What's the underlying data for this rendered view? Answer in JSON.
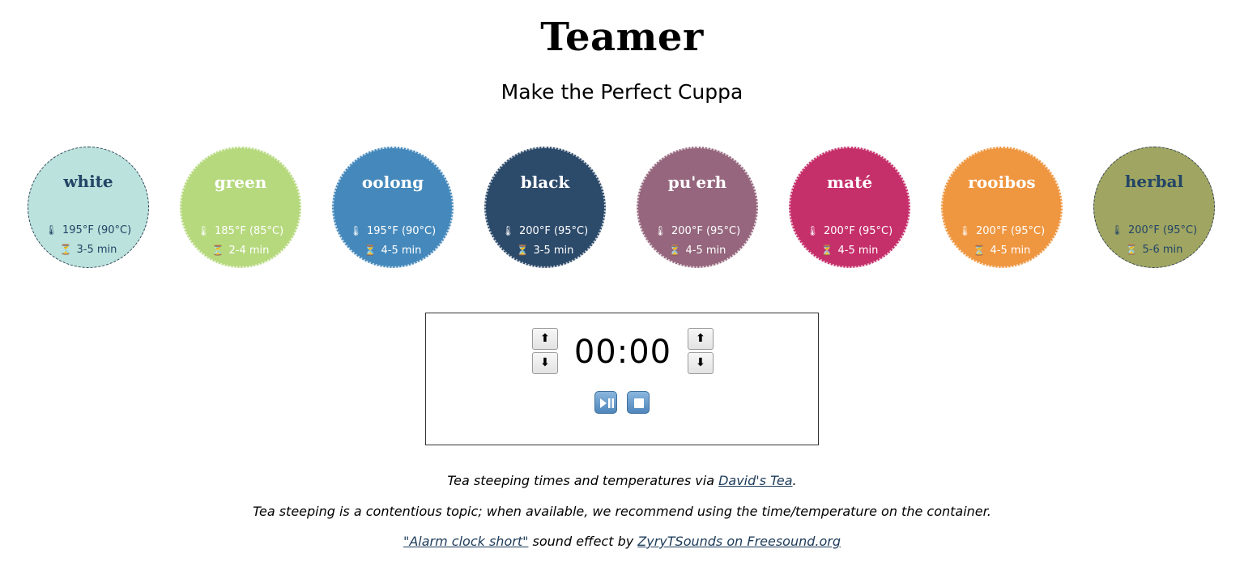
{
  "header": {
    "title": "Teamer",
    "subtitle": "Make the Perfect Cuppa"
  },
  "teas": [
    {
      "name": "white",
      "temp": "195°F (90°C)",
      "time": "3-5 min",
      "color": "#bbe2dc",
      "text_color": "#234566"
    },
    {
      "name": "green",
      "temp": "185°F (85°C)",
      "time": "2-4 min",
      "color": "#b6d97e",
      "text_color": "#ffffff"
    },
    {
      "name": "oolong",
      "temp": "195°F (90°C)",
      "time": "4-5 min",
      "color": "#4589bc",
      "text_color": "#ffffff"
    },
    {
      "name": "black",
      "temp": "200°F (95°C)",
      "time": "3-5 min",
      "color": "#2c4a6a",
      "text_color": "#ffffff"
    },
    {
      "name": "pu'erh",
      "temp": "200°F (95°C)",
      "time": "4-5 min",
      "color": "#95667d",
      "text_color": "#ffffff"
    },
    {
      "name": "maté",
      "temp": "200°F (95°C)",
      "time": "4-5 min",
      "color": "#c52f6a",
      "text_color": "#ffffff"
    },
    {
      "name": "rooibos",
      "temp": "200°F (95°C)",
      "time": "4-5 min",
      "color": "#ef9640",
      "text_color": "#ffffff"
    },
    {
      "name": "herbal",
      "temp": "200°F (95°C)",
      "time": "5-6 min",
      "color": "#a0a662",
      "text_color": "#234566"
    }
  ],
  "icons": {
    "thermometer": "🌡",
    "hourglass": "⏳",
    "up_arrow": "⬆",
    "down_arrow": "⬇"
  },
  "timer": {
    "display": "00:00"
  },
  "credits": {
    "line1_before": "Tea steeping times and temperatures via ",
    "line1_link": "David's Tea",
    "line1_after": ".",
    "line2": "Tea steeping is a contentious topic; when available, we recommend using the time/temperature on the container.",
    "line3_link1": "\"Alarm clock short\"",
    "line3_middle": " sound effect by ",
    "line3_link2": "ZyryTSounds on Freesound.org"
  }
}
